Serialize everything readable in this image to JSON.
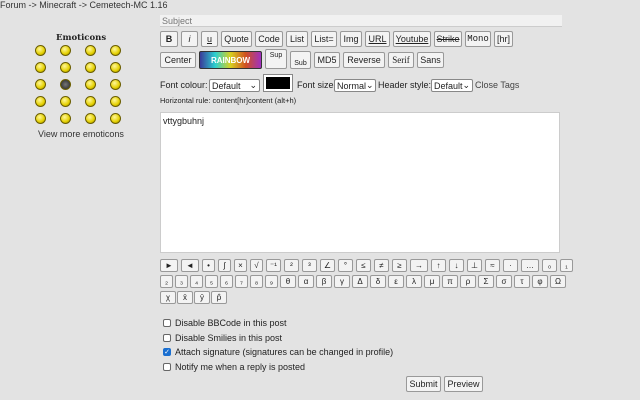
{
  "breadcrumb": "Forum -> Minecraft -> Cemetech-MC 1.16",
  "emoticons": {
    "title": "Emoticons",
    "view_more": "View more emoticons"
  },
  "subject": {
    "placeholder": "Subject",
    "value": ""
  },
  "toolbar": {
    "row1": [
      "B",
      "i",
      "u",
      "Quote",
      "Code",
      "List",
      "List=",
      "Img",
      "URL",
      "Youtube",
      "Strike",
      "Mono",
      "[hr]"
    ],
    "row2": [
      "Center",
      "RAINBOW",
      "Sup",
      "Sub",
      "MD5",
      "Reverse",
      "Serif",
      "Sans"
    ],
    "font_colour_label": "Font colour:",
    "font_colour": "Default",
    "swatch_color": "#000000",
    "font_size_label": "Font size:",
    "font_size": "Normal",
    "header_style_label": "Header style:",
    "header_style": "Default",
    "close_tags": "Close Tags",
    "hr_hint": "Horizontal rule: content[hr]content (alt+h)"
  },
  "message": "vttygbuhnj",
  "symbols": [
    "►",
    "◄",
    "•",
    "∫",
    "×",
    "√",
    "⁻¹",
    "²",
    "³",
    "∠",
    "°",
    "≤",
    "≠",
    "≥",
    "→",
    "↑",
    "↓",
    "⊥",
    "≈",
    "·",
    "…",
    "₀",
    "₁",
    "₂",
    "₃",
    "₄",
    "₅",
    "₆",
    "₇",
    "₈",
    "₉",
    "θ",
    "α",
    "β",
    "γ",
    "Δ",
    "δ",
    "ε",
    "λ",
    "μ",
    "π",
    "ρ",
    "Σ",
    "σ",
    "τ",
    "φ",
    "Ω",
    "χ",
    "x̄",
    "ȳ",
    "p̂"
  ],
  "options": [
    {
      "label": "Disable BBCode in this post",
      "checked": false
    },
    {
      "label": "Disable Smilies in this post",
      "checked": false
    },
    {
      "label": "Attach signature (signatures can be changed in profile)",
      "checked": true
    },
    {
      "label": "Notify me when a reply is posted",
      "checked": false
    }
  ],
  "submit": "Submit",
  "preview": "Preview"
}
